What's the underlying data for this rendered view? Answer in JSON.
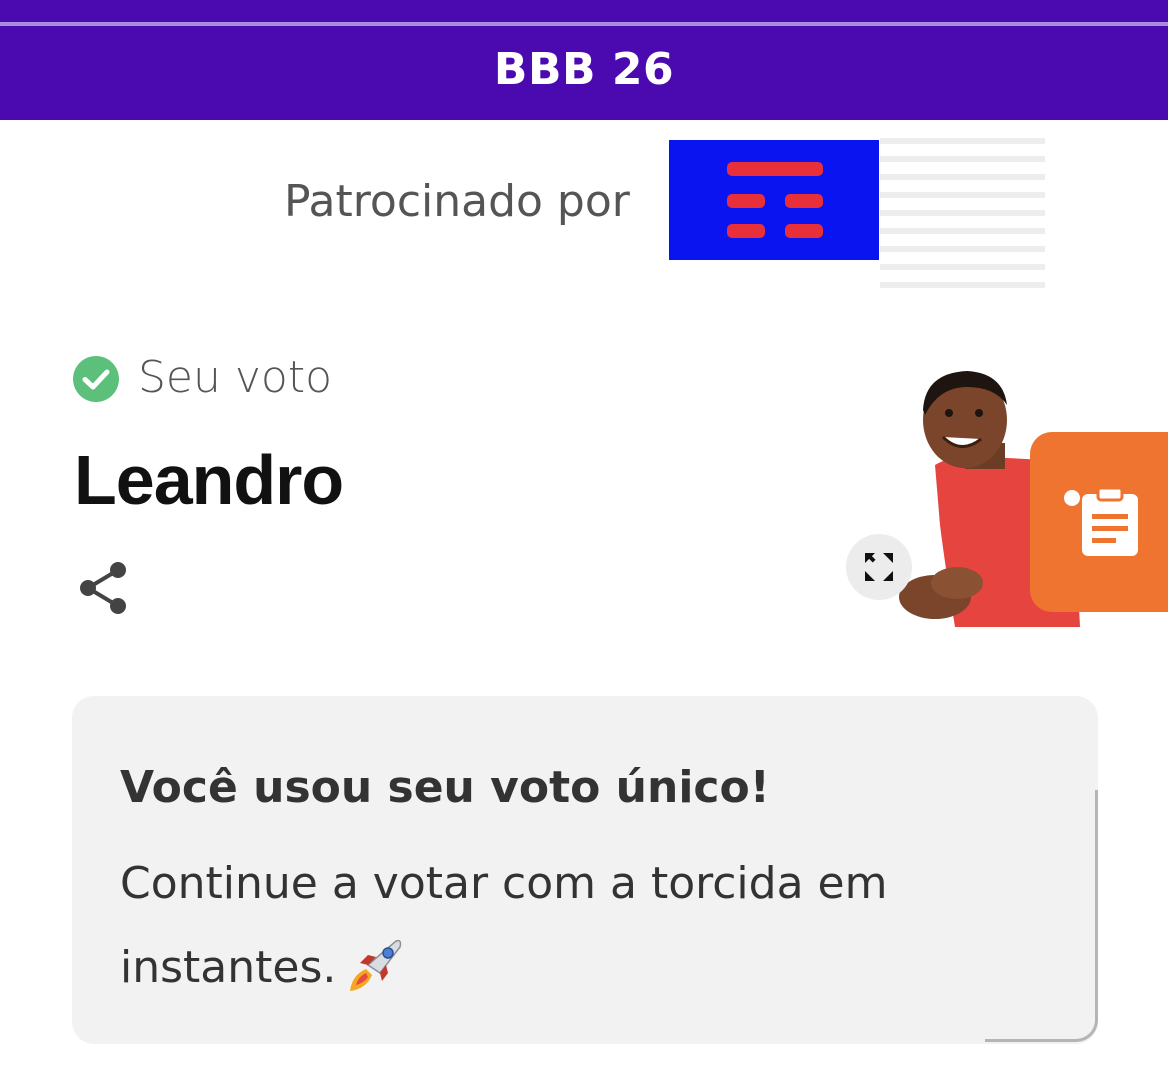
{
  "header": {
    "title": "BBB 26",
    "color": "#4a0ab0"
  },
  "sponsor": {
    "label": "Patrocinado por",
    "logo_color": "#0a14f0",
    "logo_mark_color": "#e8303a"
  },
  "vote": {
    "status_icon": "check-circle-icon",
    "status_label": "Seu voto",
    "candidate_name": "Leandro",
    "share_icon": "share-icon",
    "expand_icon": "expand-icon",
    "photo": "candidate-photo"
  },
  "floating_tab": {
    "icon": "clipboard-icon",
    "color": "#ee7430"
  },
  "message": {
    "title": "Você usou seu voto único!",
    "text": "Continue a votar com a torcida em instantes.",
    "icon": "rocket-icon"
  }
}
